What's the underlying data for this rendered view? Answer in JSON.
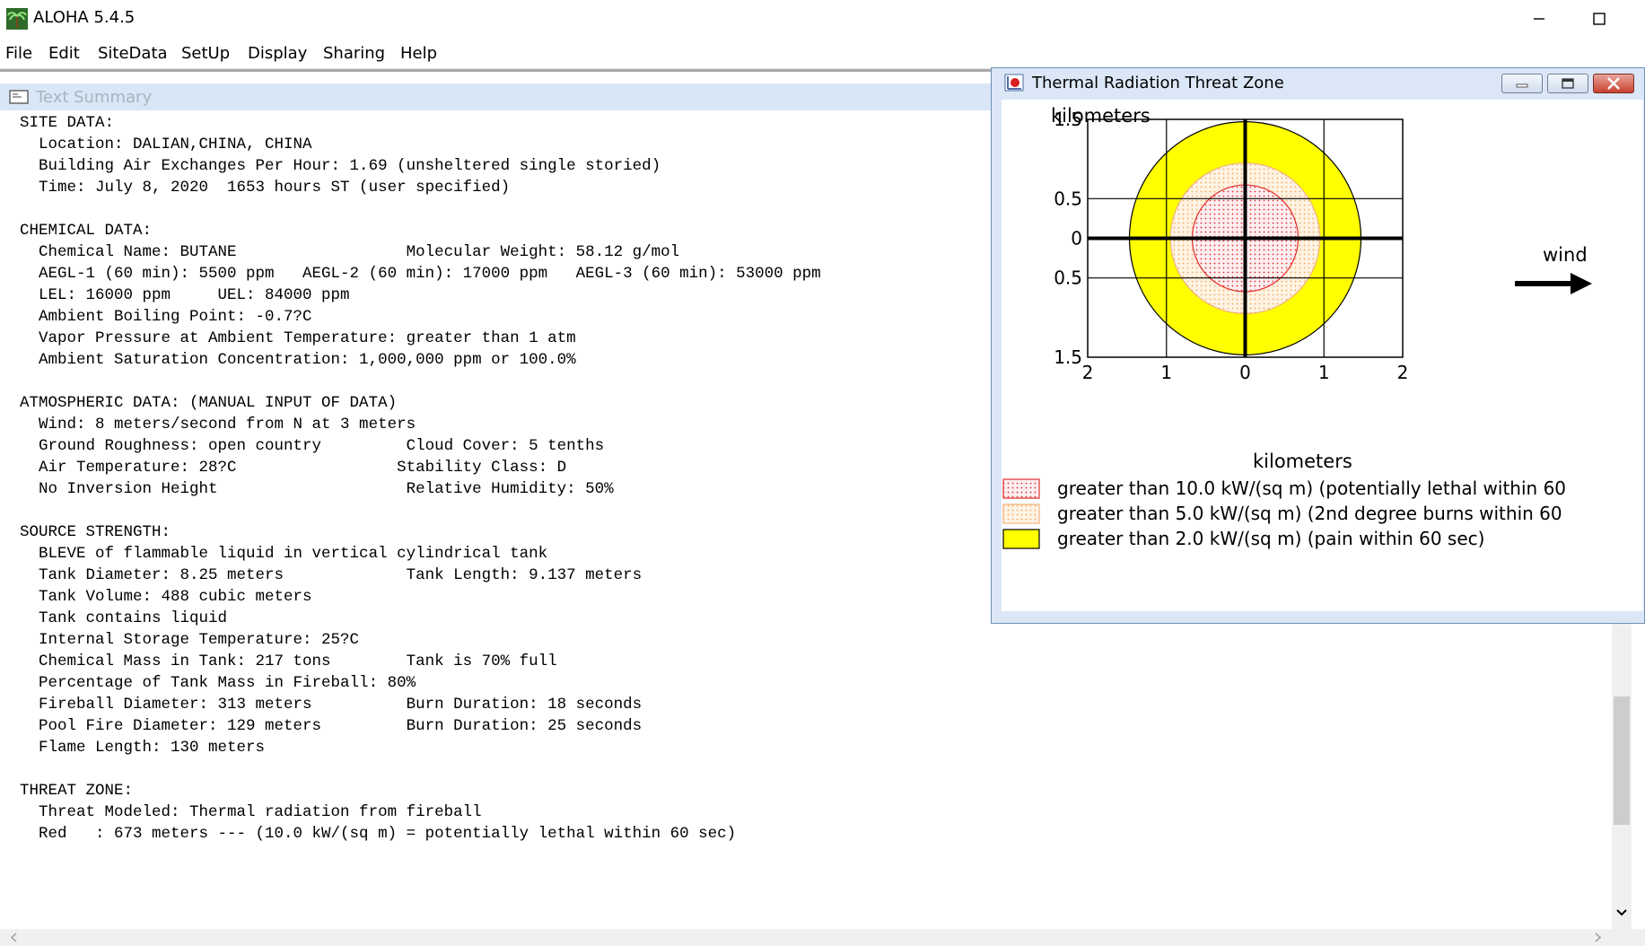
{
  "app": {
    "title": "ALOHA 5.4.5",
    "icon": "palm-tree-icon",
    "window_controls": [
      "minimize-icon",
      "maximize-icon"
    ]
  },
  "menu": [
    "File",
    "Edit",
    "SiteData",
    "SetUp",
    "Display",
    "Sharing",
    "Help"
  ],
  "text_summary": {
    "title": "Text Summary",
    "lines": [
      "SITE DATA:",
      "  Location: DALIAN,CHINA, CHINA",
      "  Building Air Exchanges Per Hour: 1.69 (unsheltered single storied)",
      "  Time: July 8, 2020  1653 hours ST (user specified)",
      "",
      "CHEMICAL DATA:",
      "  Chemical Name: BUTANE                  Molecular Weight: 58.12 g/mol",
      "  AEGL-1 (60 min): 5500 ppm   AEGL-2 (60 min): 17000 ppm   AEGL-3 (60 min): 53000 ppm",
      "  LEL: 16000 ppm     UEL: 84000 ppm",
      "  Ambient Boiling Point: -0.7?C",
      "  Vapor Pressure at Ambient Temperature: greater than 1 atm",
      "  Ambient Saturation Concentration: 1,000,000 ppm or 100.0%",
      "",
      "ATMOSPHERIC DATA: (MANUAL INPUT OF DATA)",
      "  Wind: 8 meters/second from N at 3 meters",
      "  Ground Roughness: open country         Cloud Cover: 5 tenths",
      "  Air Temperature: 28?C                 Stability Class: D",
      "  No Inversion Height                    Relative Humidity: 50%",
      "",
      "SOURCE STRENGTH:",
      "  BLEVE of flammable liquid in vertical cylindrical tank",
      "  Tank Diameter: 8.25 meters             Tank Length: 9.137 meters",
      "  Tank Volume: 488 cubic meters",
      "  Tank contains liquid",
      "  Internal Storage Temperature: 25?C",
      "  Chemical Mass in Tank: 217 tons        Tank is 70% full",
      "  Percentage of Tank Mass in Fireball: 80%",
      "  Fireball Diameter: 313 meters          Burn Duration: 18 seconds",
      "  Pool Fire Diameter: 129 meters         Burn Duration: 25 seconds",
      "  Flame Length: 130 meters",
      "",
      "THREAT ZONE:",
      "  Threat Modeled: Thermal radiation from fireball",
      "  Red   : 673 meters --- (10.0 kW/(sq m) = potentially lethal within 60 sec)"
    ]
  },
  "threat_window": {
    "title": "Thermal Radiation Threat Zone",
    "icon": "threat-zone-icon",
    "controls": [
      "minimize-icon",
      "restore-icon",
      "close-icon"
    ]
  },
  "chart_data": {
    "type": "threat-zone-plot",
    "ylabel": "kilometers",
    "xlabel": "kilometers",
    "y_tick_labels": [
      "1.5",
      "0.5",
      "0",
      "0.5",
      "1.5"
    ],
    "x_tick_labels": [
      "2",
      "1",
      "0",
      "1",
      "2"
    ],
    "xlim": [
      -2,
      2
    ],
    "ylim": [
      -1.5,
      1.5
    ],
    "grid": true,
    "wind_label": "wind",
    "wind_direction": "east",
    "zones": [
      {
        "name": "red",
        "radius_km": 0.673,
        "fill": "#fbe8ea",
        "stroke": "#e0302c",
        "pattern": "red-dots",
        "legend": "greater than 10.0 kW/(sq m) (potentially lethal within 60"
      },
      {
        "name": "orange",
        "radius_km": 0.95,
        "fill": "#fde5c4",
        "stroke": "#f0b27a",
        "pattern": "orange-dots",
        "legend": "greater than 5.0 kW/(sq m) (2nd degree burns within 60"
      },
      {
        "name": "yellow",
        "radius_km": 1.47,
        "fill": "#ffff00",
        "stroke": "#000000",
        "pattern": "solid",
        "legend": "greater than 2.0 kW/(sq m) (pain within 60 sec)"
      }
    ]
  }
}
